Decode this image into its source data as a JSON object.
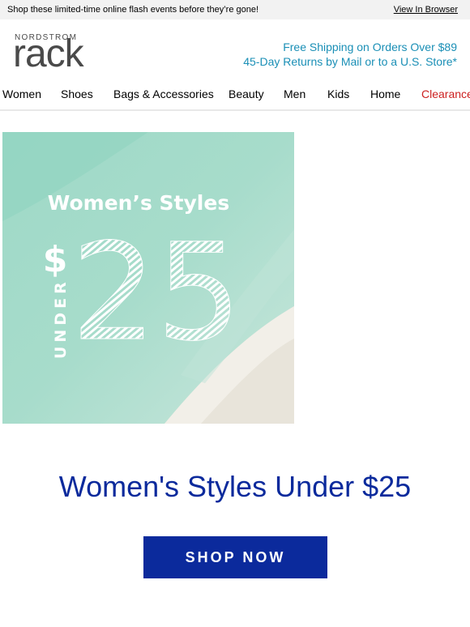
{
  "preheader": {
    "message": "Shop these limited-time online flash events before they’re gone!",
    "view_in_browser": "View In Browser"
  },
  "brand": {
    "top_word": "NORDSTROM",
    "main_word": "rack"
  },
  "promo": {
    "line1": "Free Shipping on Orders Over $89",
    "line2": "45-Day Returns by Mail or to a U.S. Store*"
  },
  "nav": {
    "items": [
      "Women",
      "Shoes",
      "Bags & Accessories",
      "Beauty",
      "Men",
      "Kids",
      "Home",
      "Clearance"
    ]
  },
  "hero": {
    "title": "Women’s Styles",
    "vertical_word": "UNDER",
    "currency": "$",
    "amount": "25"
  },
  "headline": "Women's Styles Under $25",
  "cta_label": "SHOP NOW",
  "colors": {
    "accent_blue": "#0b2a9c",
    "promo_teal": "#1a8fb6",
    "clearance_red": "#cc1f1f"
  }
}
